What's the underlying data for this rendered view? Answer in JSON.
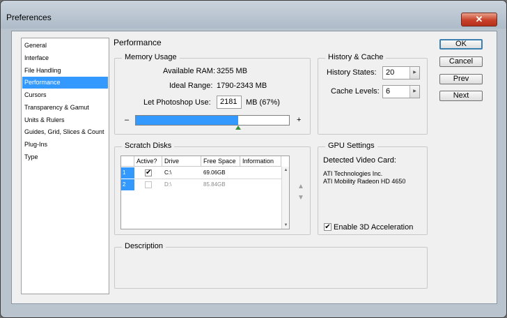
{
  "window": {
    "title": "Preferences",
    "close_glyph": "✕"
  },
  "sidebar": {
    "items": [
      {
        "label": "General"
      },
      {
        "label": "Interface"
      },
      {
        "label": "File Handling"
      },
      {
        "label": "Performance"
      },
      {
        "label": "Cursors"
      },
      {
        "label": "Transparency & Gamut"
      },
      {
        "label": "Units & Rulers"
      },
      {
        "label": "Guides, Grid, Slices & Count"
      },
      {
        "label": "Plug-Ins"
      },
      {
        "label": "Type"
      }
    ],
    "selected": "Performance"
  },
  "section_title": "Performance",
  "memory": {
    "group_label": "Memory Usage",
    "available_label": "Available RAM:",
    "available_value": "3255 MB",
    "ideal_label": "Ideal Range:",
    "ideal_value": "1790-2343 MB",
    "let_label": "Let Photoshop Use:",
    "let_value": "2181",
    "let_suffix": "MB (67%)",
    "slider_minus": "–",
    "slider_plus": "+",
    "slider_percent": 67
  },
  "history": {
    "group_label": "History & Cache",
    "states_label": "History States:",
    "states_value": "20",
    "levels_label": "Cache Levels:",
    "levels_value": "6"
  },
  "scratch": {
    "group_label": "Scratch Disks",
    "columns": [
      "",
      "Active?",
      "Drive",
      "Free Space",
      "Information"
    ],
    "rows": [
      {
        "num": "1",
        "active": true,
        "drive": "C:\\",
        "free": "69.06GB",
        "info": ""
      },
      {
        "num": "2",
        "active": false,
        "drive": "D:\\",
        "free": "85.84GB",
        "info": ""
      }
    ],
    "move_up": "▲",
    "move_down": "▼"
  },
  "gpu": {
    "group_label": "GPU Settings",
    "detected_label": "Detected Video Card:",
    "card_line1": "ATI Technologies Inc.",
    "card_line2": "ATI Mobility Radeon HD 4650",
    "accel_label": "Enable 3D Acceleration",
    "accel_checked": true
  },
  "description": {
    "group_label": "Description",
    "text": ""
  },
  "buttons": {
    "ok": "OK",
    "cancel": "Cancel",
    "prev": "Prev",
    "next": "Next"
  },
  "colors": {
    "accent": "#3399ff",
    "window_frame": "#b9c4cf",
    "close": "#c8412a"
  }
}
